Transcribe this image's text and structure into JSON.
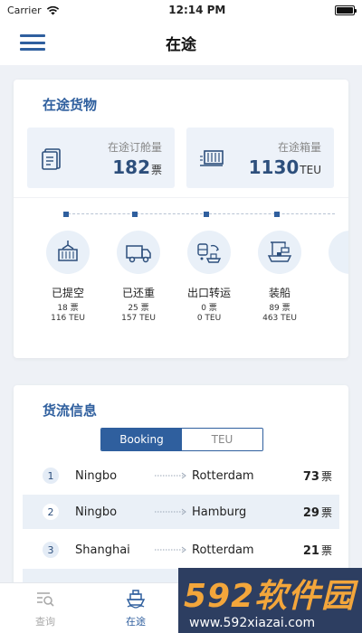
{
  "status_bar": {
    "carrier": "Carrier",
    "time": "12:14 PM"
  },
  "nav": {
    "title": "在途"
  },
  "cargo": {
    "title": "在途货物",
    "booking": {
      "label": "在途订舱量",
      "value": "182",
      "unit": "票"
    },
    "containers": {
      "label": "在途箱量",
      "value": "1130",
      "unit": "TEU"
    },
    "stages": [
      {
        "name": "已提空",
        "tickets": "18 票",
        "teu": "116 TEU",
        "icon": "empty-container-lift-icon"
      },
      {
        "name": "已还重",
        "tickets": "25 票",
        "teu": "157 TEU",
        "icon": "truck-icon"
      },
      {
        "name": "出口转运",
        "tickets": "0 票",
        "teu": "0 TEU",
        "icon": "transfer-icon"
      },
      {
        "name": "装船",
        "tickets": "89 票",
        "teu": "463 TEU",
        "icon": "ship-loading-icon"
      }
    ]
  },
  "flow": {
    "title": "货流信息",
    "toggle": {
      "booking": "Booking",
      "teu": "TEU"
    },
    "rows": [
      {
        "rank": "1",
        "origin": "Ningbo",
        "dest": "Rotterdam",
        "count": "73",
        "unit": "票"
      },
      {
        "rank": "2",
        "origin": "Ningbo",
        "dest": "Hamburg",
        "count": "29",
        "unit": "票"
      },
      {
        "rank": "3",
        "origin": "Shanghai",
        "dest": "Rotterdam",
        "count": "21",
        "unit": "票"
      }
    ]
  },
  "tabs": {
    "query": "查询",
    "transit": "在途"
  },
  "watermark": {
    "main": "592软件园",
    "sub": "www.592xiazai.com"
  },
  "colors": {
    "accent": "#2f5f9e",
    "value": "#2d4f7c",
    "panel": "#edf2f9"
  }
}
